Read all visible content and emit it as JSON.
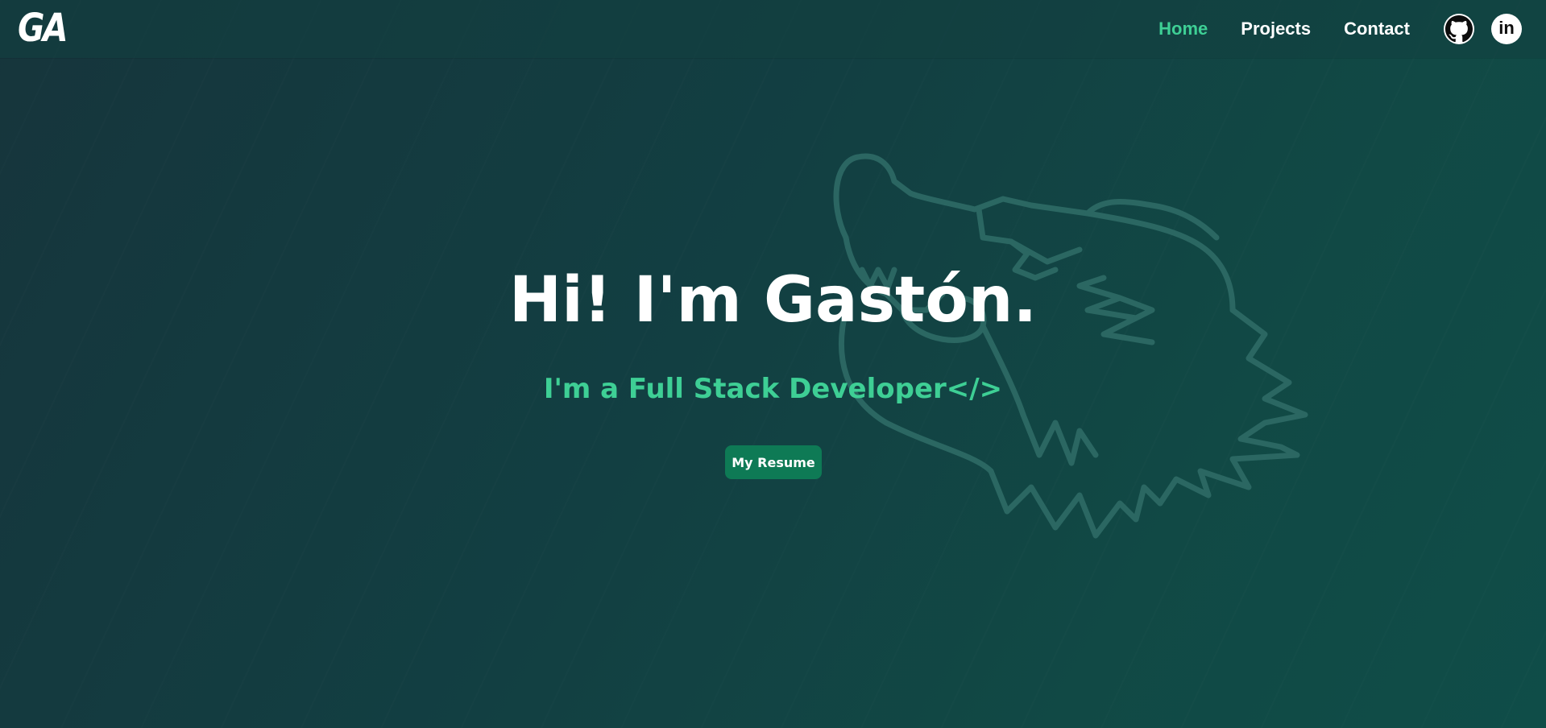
{
  "logo": {
    "text": "GA"
  },
  "nav": {
    "items": [
      {
        "label": "Home",
        "active": true
      },
      {
        "label": "Projects",
        "active": false
      },
      {
        "label": "Contact",
        "active": false
      }
    ],
    "social": [
      {
        "icon": "github-icon"
      },
      {
        "icon": "linkedin-icon",
        "text": "in"
      }
    ]
  },
  "hero": {
    "title": "Hi! I'm Gastón.",
    "subtitle": "I'm a Full Stack Developer</>",
    "button_label": "My Resume"
  },
  "background": {
    "decoration": "wolf-outline-illustration"
  },
  "colors": {
    "accent": "#3ecf95",
    "button": "#0e7a55",
    "background_start": "#16353c",
    "background_end": "#0f4d48",
    "text": "#ffffff"
  }
}
